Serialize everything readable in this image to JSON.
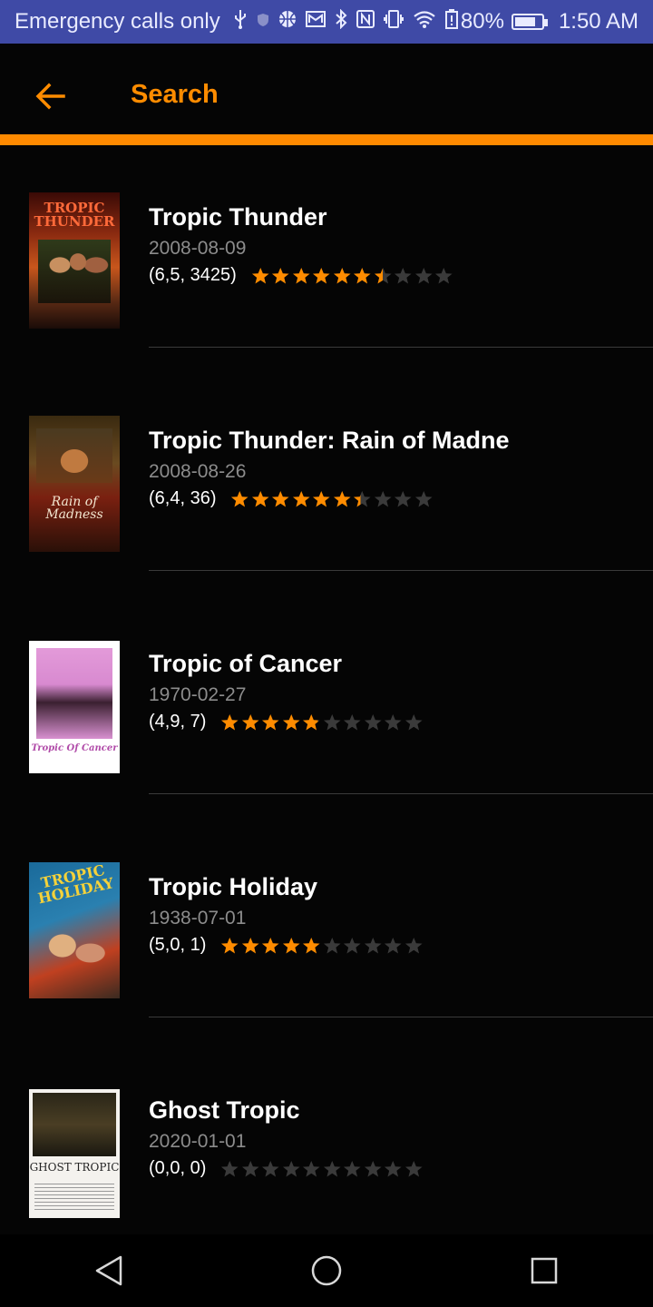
{
  "status_bar": {
    "carrier_text": "Emergency calls only",
    "battery": "80%",
    "battery_level": 0.8,
    "time": "1:50 AM",
    "icons": [
      "usb-icon",
      "shield-icon",
      "basketball-icon",
      "mail-icon",
      "bluetooth-icon",
      "nfc-icon",
      "vibrate-icon",
      "wifi-icon",
      "battery-alert-icon",
      "battery-icon"
    ]
  },
  "appbar": {
    "title": "Search",
    "back_icon": "arrow-left-icon"
  },
  "colors": {
    "accent": "#ff8c00",
    "background": "#050505",
    "status_bar": "#3f4aa6",
    "star_filled": "#ff8c00",
    "star_empty": "#3a3a3a",
    "date_text": "#8c8c8c"
  },
  "results": [
    {
      "title": "Tropic Thunder",
      "date": "2008-08-09",
      "rating_text": "(6,5, 3425)",
      "rating": 6.5,
      "votes": 3425,
      "poster_text": "TROPIC THUNDER"
    },
    {
      "title": "Tropic Thunder: Rain of Madne",
      "date": "2008-08-26",
      "rating_text": "(6,4, 36)",
      "rating": 6.4,
      "votes": 36,
      "poster_text": "Rain of Madness"
    },
    {
      "title": "Tropic of Cancer",
      "date": "1970-02-27",
      "rating_text": "(4,9, 7)",
      "rating": 4.9,
      "votes": 7,
      "poster_text": "Tropic Of Cancer"
    },
    {
      "title": "Tropic Holiday",
      "date": "1938-07-01",
      "rating_text": "(5,0, 1)",
      "rating": 5.0,
      "votes": 1,
      "poster_text": "TROPIC HOLIDAY"
    },
    {
      "title": "Ghost Tropic",
      "date": "2020-01-01",
      "rating_text": "(0,0, 0)",
      "rating": 0.0,
      "votes": 0,
      "poster_text": "GHOST TROPIC"
    }
  ],
  "nav_bar": {
    "back": "nav-back-icon",
    "home": "nav-home-icon",
    "recents": "nav-recents-icon"
  }
}
